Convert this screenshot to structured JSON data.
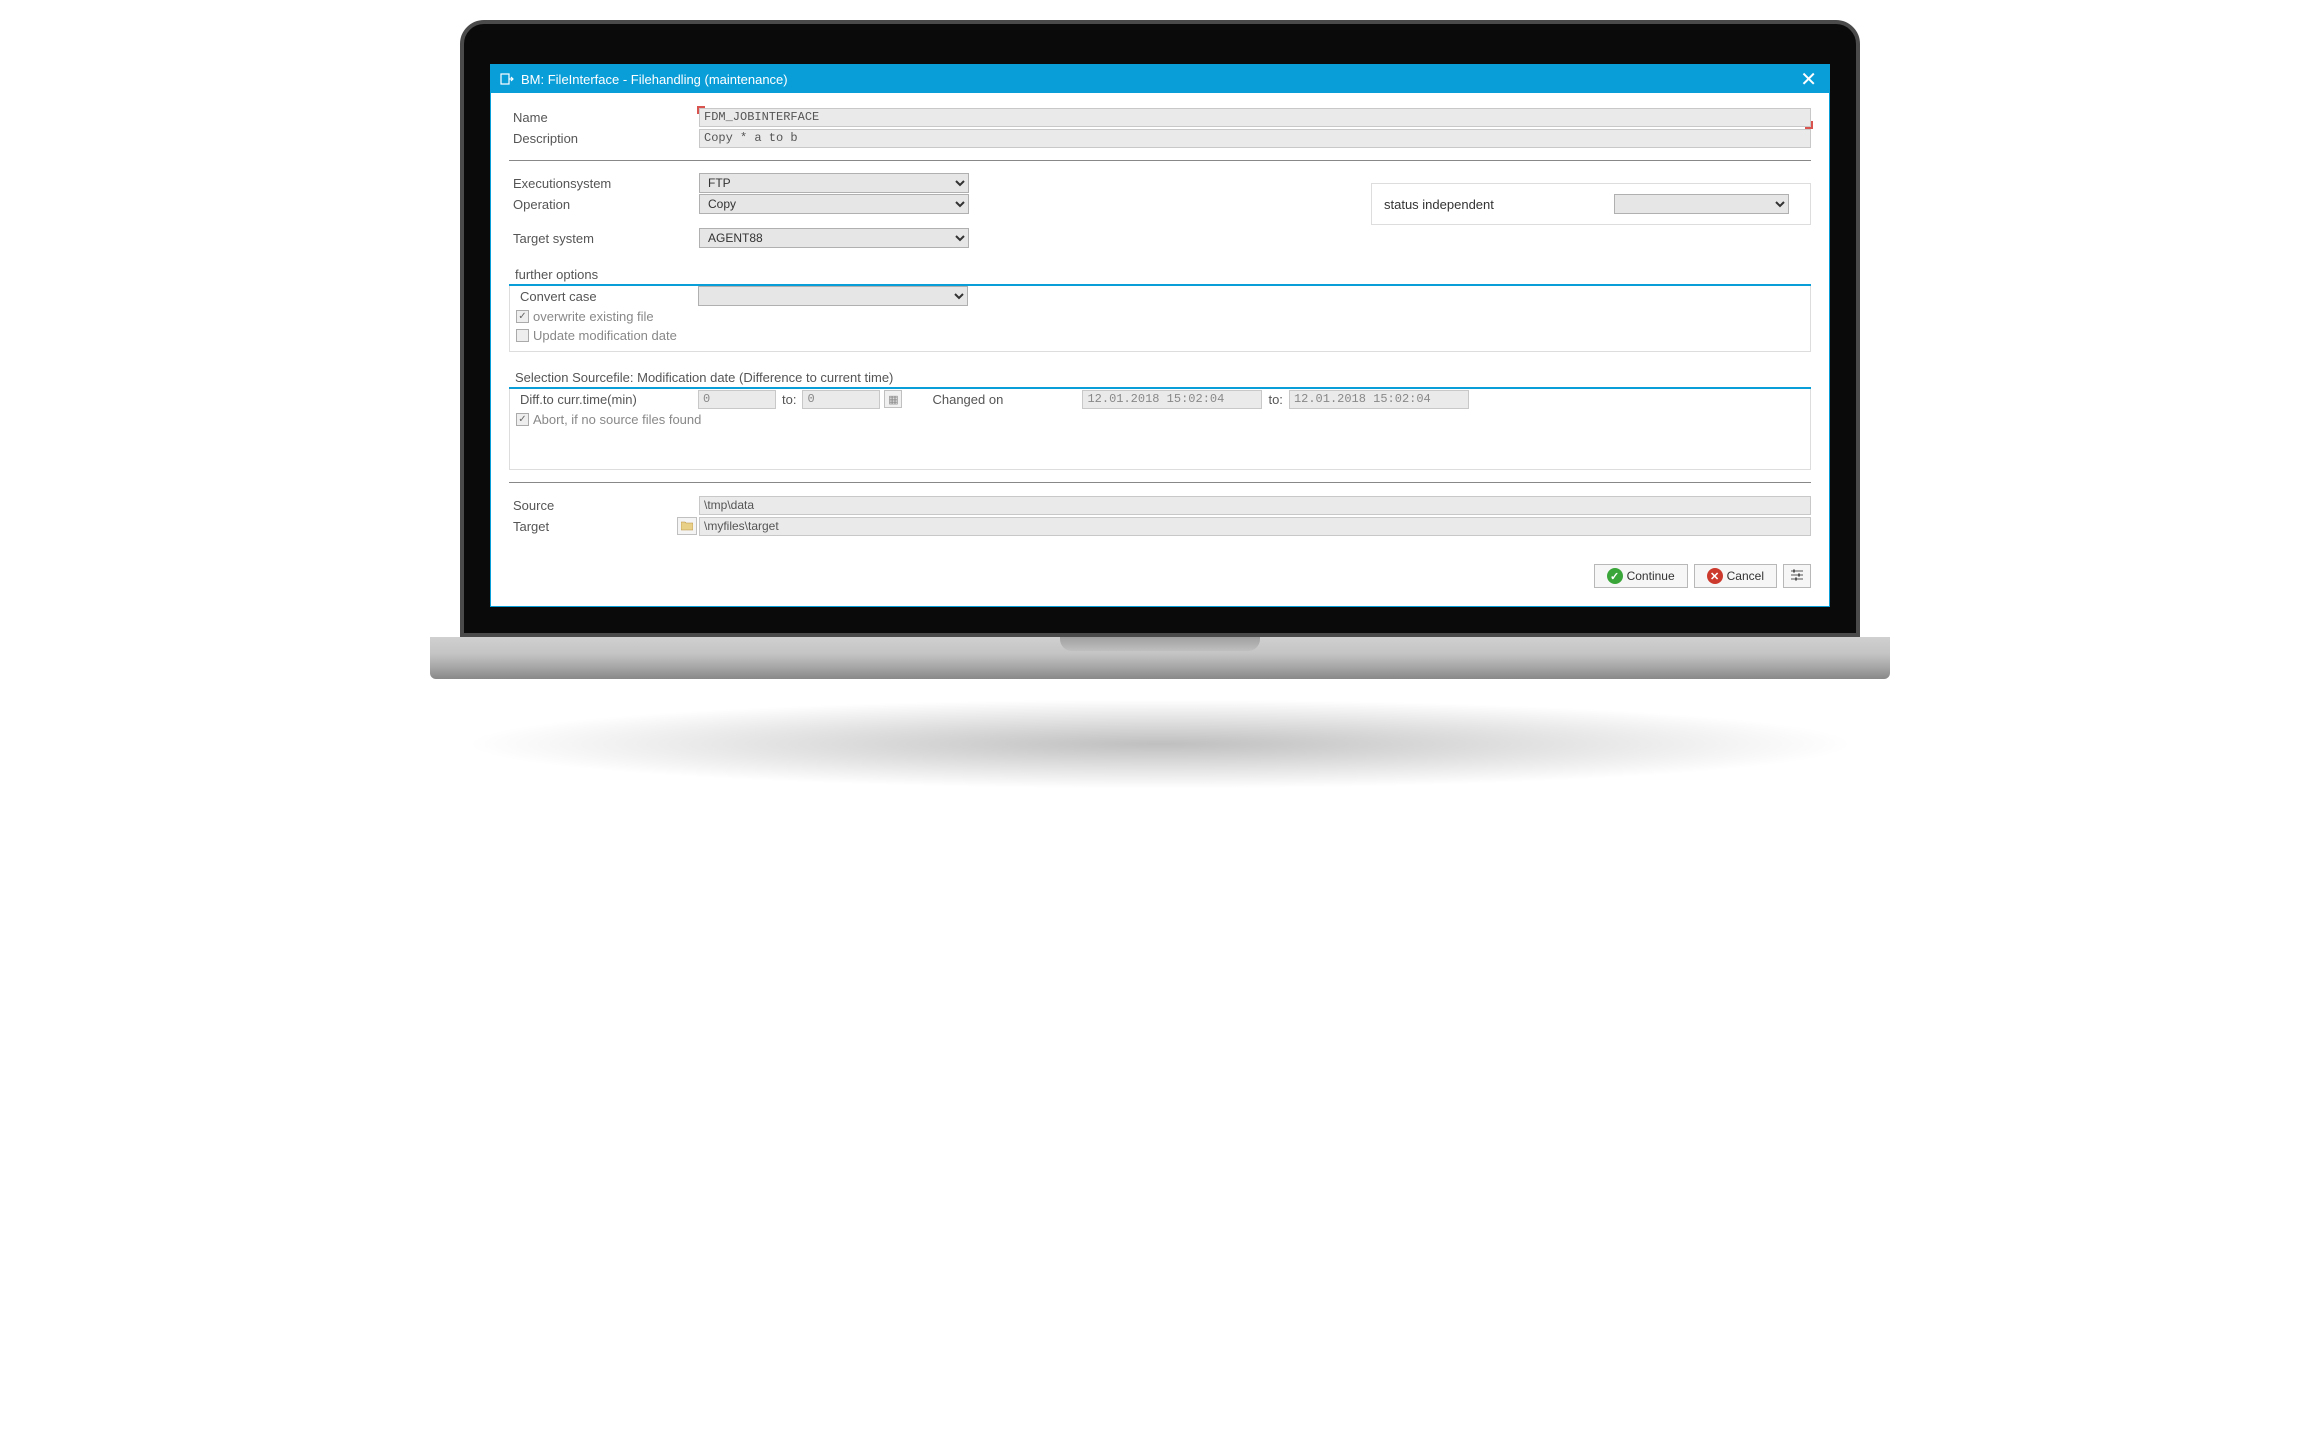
{
  "titlebar": {
    "title": "BM: FileInterface - Filehandling (maintenance)"
  },
  "fields": {
    "name_label": "Name",
    "name_value": "FDM_JOBINTERFACE",
    "description_label": "Description",
    "description_value": "Copy * a to b",
    "executionsystem_label": "Executionsystem",
    "executionsystem_value": "FTP",
    "operation_label": "Operation",
    "operation_value": "Copy",
    "target_system_label": "Target system",
    "target_system_value": "AGENT88",
    "status_label": "status independent",
    "status_value": ""
  },
  "further_options": {
    "title": "further options",
    "convert_case_label": "Convert case",
    "convert_case_value": "",
    "overwrite_label": "overwrite existing file",
    "update_moddate_label": "Update modification date"
  },
  "selection": {
    "title": "Selection Sourcefile: Modification date (Difference to current time)",
    "diff_label": "Diff.to curr.time(min)",
    "diff_from": "0",
    "to_label": "to:",
    "diff_to": "0",
    "changed_on_label": "Changed on",
    "changed_from": "12.01.2018 15:02:04",
    "changed_to": "12.01.2018 15:02:04",
    "abort_label": "Abort, if no source files found"
  },
  "paths": {
    "source_label": "Source",
    "source_value": "\\tmp\\data",
    "target_label": "Target",
    "target_value": "\\myfiles\\target"
  },
  "buttons": {
    "continue": "Continue",
    "cancel": "Cancel"
  }
}
